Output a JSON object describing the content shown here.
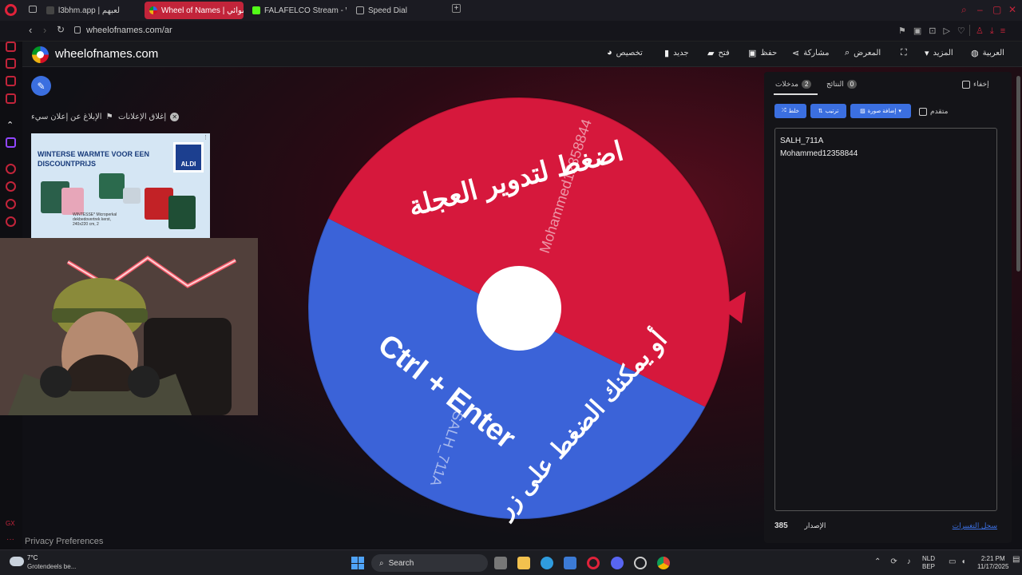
{
  "browser": {
    "tabs": [
      {
        "label": "l3bhm.app | لعبهم"
      },
      {
        "label": "Wheel of Names | عشوائي"
      },
      {
        "label": "FALAFELCO Stream - Wa"
      },
      {
        "label": "Speed Dial"
      }
    ],
    "url": "wheelofnames.com/ar"
  },
  "header": {
    "brand": "wheelofnames.com",
    "menu": [
      {
        "label": "تخصيص",
        "icon": "palette-icon"
      },
      {
        "label": "جديد",
        "icon": "new-file-icon"
      },
      {
        "label": "فتح",
        "icon": "folder-icon"
      },
      {
        "label": "حفظ",
        "icon": "save-icon"
      },
      {
        "label": "مشاركة",
        "icon": "share-icon"
      },
      {
        "label": "المعرض",
        "icon": "search-icon"
      },
      {
        "label": "",
        "icon": "fullscreen-icon"
      },
      {
        "label": "المزيد",
        "icon": "caret-down-icon"
      },
      {
        "label": "العربية",
        "icon": "globe-icon"
      }
    ]
  },
  "left": {
    "close_ads": "إغلاق الإعلانات",
    "report_ad": "الإبلاغ عن إعلان سيء",
    "ad": {
      "title": "WINTERSE WARMTE VOOR EEN DISCOUNTPRIJS",
      "brand": "ALDI",
      "fine_print": "WINTESSE* Microperkal dekbedovertrek kerst, 240x220 cm, 2"
    },
    "privacy": "Privacy Preferences"
  },
  "wheel": {
    "colors": {
      "red": "#d6183c",
      "blue": "#3b63d8"
    },
    "segments": [
      {
        "name": "Mohammed12358844",
        "color": "red"
      },
      {
        "name": "SALH_711A",
        "color": "blue"
      }
    ],
    "prompt_line1": "اضغط لتدوير العجلة",
    "prompt_line2": "أو يمكنك الضغط على زر",
    "prompt_keys": "Ctrl + Enter"
  },
  "panel": {
    "hide_label": "إخفاء",
    "tab_results": {
      "label": "النتائج",
      "count": "0"
    },
    "tab_entries": {
      "label": "مدخلات",
      "count": "2"
    },
    "shuffle_label": "خلط",
    "sort_label": "ترتيب",
    "add_image_label": "إضافة صورة",
    "advanced_label": "متقدم",
    "entries": [
      "SALH_711A",
      "Mohammed12358844"
    ],
    "version_label": "الإصدار",
    "version": "385",
    "changelog": "سجل التغييرات"
  },
  "taskbar": {
    "weather_temp": "7°C",
    "weather_desc": "Grotendeels be...",
    "search": "Search",
    "lang": "NLD",
    "lang2": "BEP",
    "time": "2:21 PM",
    "date": "11/17/2025"
  }
}
